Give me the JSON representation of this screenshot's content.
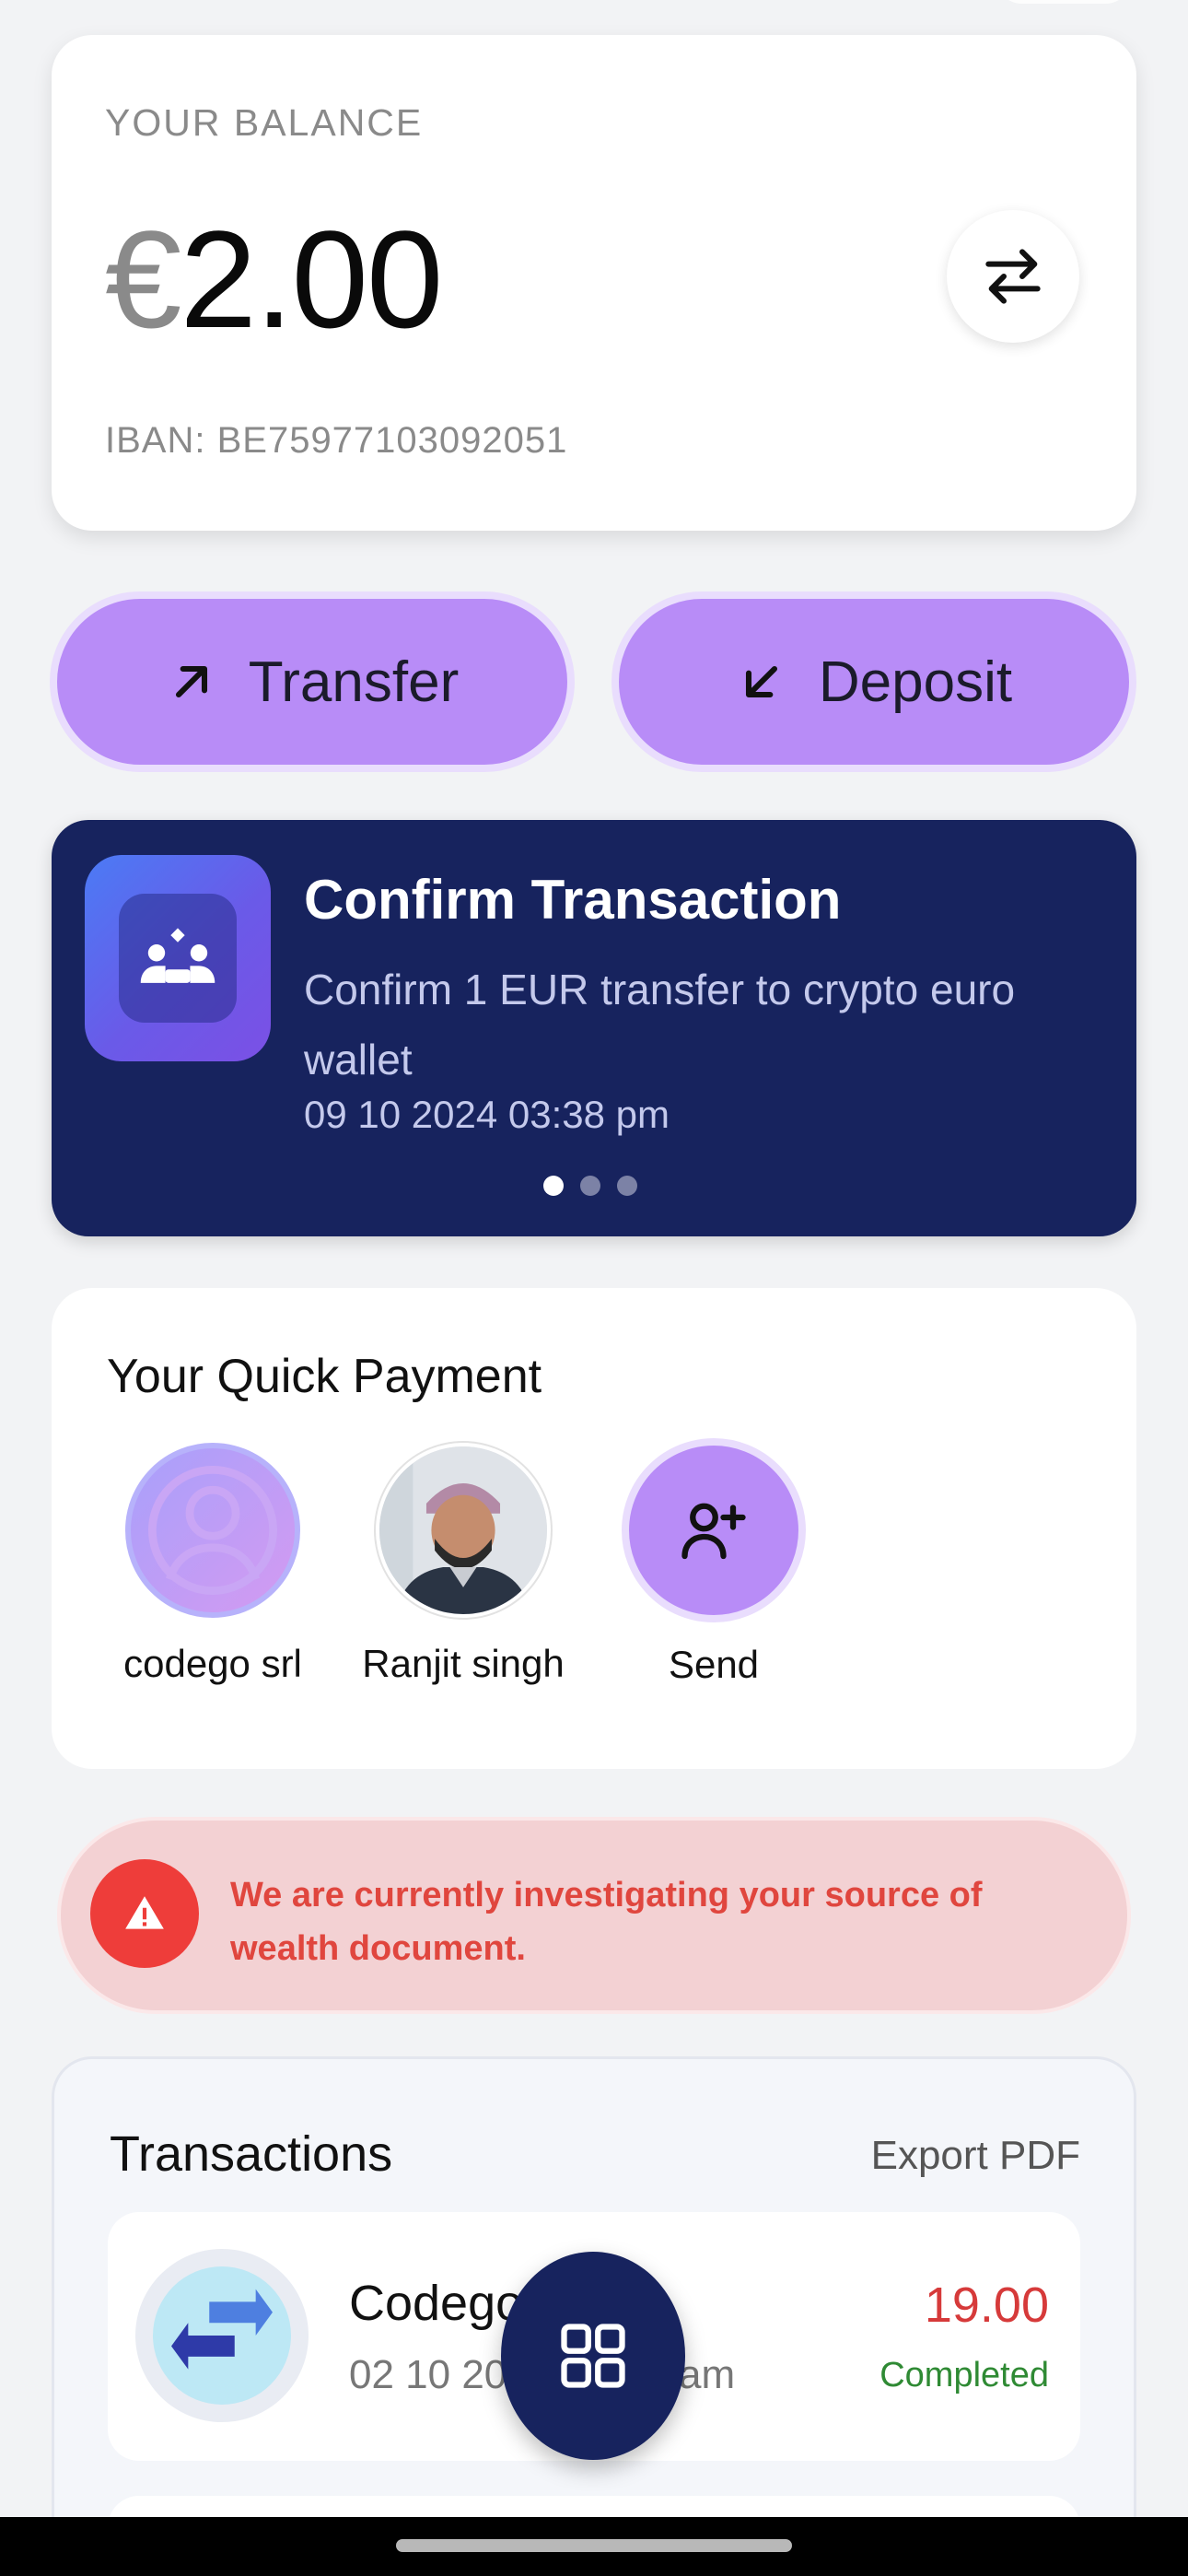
{
  "balance": {
    "label": "YOUR BALANCE",
    "currency": "€",
    "amount": "2.00",
    "iban": "IBAN: BE75977103092051"
  },
  "actions": {
    "transfer_label": "Transfer",
    "deposit_label": "Deposit"
  },
  "confirm": {
    "title": "Confirm Transaction",
    "description": "Confirm 1 EUR transfer to crypto euro wallet",
    "date": "09 10 2024 03:38 pm",
    "pages": 3,
    "active_page": 1
  },
  "quick_payment": {
    "title": "Your Quick Payment",
    "contacts": [
      {
        "name": "codego srl",
        "icon": "user-icon"
      },
      {
        "name": "Ranjit singh",
        "icon": "profile-photo"
      },
      {
        "name": "Send",
        "icon": "add-user-icon"
      }
    ]
  },
  "alert": {
    "text": "We are currently investigating your source of wealth document.",
    "icon": "warning-icon",
    "color": "#ee3d3a"
  },
  "transactions": {
    "title": "Transactions",
    "export_label": "Export PDF",
    "items": [
      {
        "name": "Codego",
        "date": "02 10 20",
        "time_suffix": "0 am",
        "amount": "19.00",
        "status": "Completed"
      }
    ]
  },
  "colors": {
    "accent": "#b88cf7",
    "navy": "#17235e",
    "negative": "#d63a3a",
    "positive": "#2f8a34"
  }
}
